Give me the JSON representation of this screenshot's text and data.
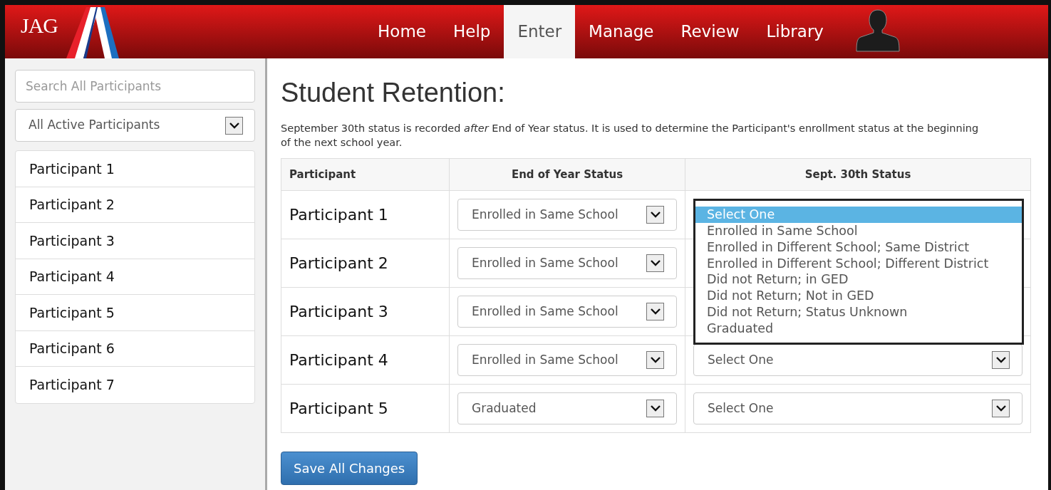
{
  "brand": {
    "logo_text": "JAG"
  },
  "nav": [
    {
      "label": "Home",
      "selected": false
    },
    {
      "label": "Help",
      "selected": false
    },
    {
      "label": "Enter",
      "selected": true
    },
    {
      "label": "Manage",
      "selected": false
    },
    {
      "label": "Review",
      "selected": false
    },
    {
      "label": "Library",
      "selected": false
    }
  ],
  "sidebar": {
    "search": {
      "placeholder": "Search All Participants"
    },
    "filter": "All Active Participants",
    "items": [
      "Participant 1",
      "Participant 2",
      "Participant 3",
      "Participant 4",
      "Participant 5",
      "Participant 6",
      "Participant 7"
    ]
  },
  "page": {
    "title": "Student Retention:",
    "description": "September 30th status is recorded *after* End of Year status. It is used to determine the Participant's enrollment status at the beginning of the next school year."
  },
  "table": {
    "columns": [
      "Participant",
      "End of Year Status",
      "Sept. 30th Status"
    ],
    "rows": [
      {
        "participant": "Participant 1",
        "end_of_year": "Enrolled in Same School"
      },
      {
        "participant": "Participant 2",
        "end_of_year": "Enrolled in Same School"
      },
      {
        "participant": "Participant 3",
        "end_of_year": "Enrolled in Same School"
      },
      {
        "participant": "Participant 4",
        "end_of_year": "Enrolled in Same School",
        "sept30": "Select One"
      },
      {
        "participant": "Participant 5",
        "end_of_year": "Graduated",
        "sept30": "Select One"
      }
    ]
  },
  "open_dropdown": {
    "options": [
      {
        "label": "Select One",
        "selected": true
      },
      {
        "label": "Enrolled in Same School",
        "selected": false
      },
      {
        "label": "Enrolled in Different School; Same District",
        "selected": false
      },
      {
        "label": "Enrolled in Different School; Different District",
        "selected": false
      },
      {
        "label": "Did not Return; in GED",
        "selected": false
      },
      {
        "label": "Did not Return; Not in GED",
        "selected": false
      },
      {
        "label": "Did not Return; Status Unknown",
        "selected": false
      },
      {
        "label": "Graduated",
        "selected": false
      }
    ]
  },
  "buttons": [
    "Save All Changes"
  ]
}
